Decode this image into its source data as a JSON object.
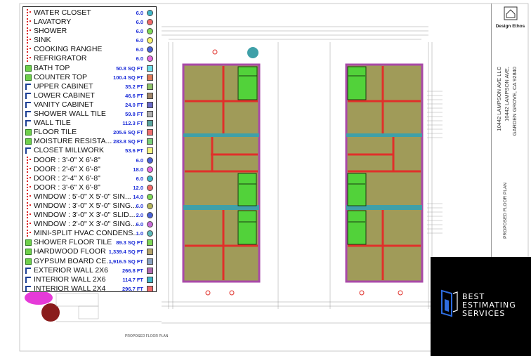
{
  "legend": {
    "items": [
      {
        "label": "WATER CLOSET",
        "value": "6.0",
        "icon": "dotted-count-icon",
        "swatch": "#3fb8c9",
        "shape": "round"
      },
      {
        "label": "LAVATORY",
        "value": "6.0",
        "icon": "dotted-count-icon",
        "swatch": "#f26a6a",
        "shape": "round"
      },
      {
        "label": "SHOWER",
        "value": "6.0",
        "icon": "dotted-count-icon",
        "swatch": "#7ed957",
        "shape": "round"
      },
      {
        "label": "SINK",
        "value": "6.0",
        "icon": "dotted-count-icon",
        "swatch": "#f5f06a",
        "shape": "round"
      },
      {
        "label": "COOKING RANGHE",
        "value": "6.0",
        "icon": "dotted-count-icon",
        "swatch": "#4a62d8",
        "shape": "round"
      },
      {
        "label": "REFRIGRATOR",
        "value": "6.0",
        "icon": "dotted-count-icon",
        "swatch": "#e96ae0",
        "shape": "round"
      },
      {
        "label": "BATH TOP",
        "value": "50.8 SQ FT",
        "icon": "area-icon",
        "swatch": "#6ee0ea",
        "shape": "square"
      },
      {
        "label": "COUNTER TOP",
        "value": "100.4 SQ FT",
        "icon": "area-icon",
        "swatch": "#e07a5a",
        "shape": "square"
      },
      {
        "label": "UPPER CABINET",
        "value": "35.2 FT",
        "icon": "linear-icon",
        "swatch": "#8fc46a",
        "shape": "square"
      },
      {
        "label": "LOWER CABINET",
        "value": "46.6 FT",
        "icon": "linear-icon",
        "swatch": "#a2876a",
        "shape": "square"
      },
      {
        "label": "VANITY CABINET",
        "value": "24.0 FT",
        "icon": "linear-icon",
        "swatch": "#6a6ac9",
        "shape": "square"
      },
      {
        "label": "SHOWER WALL TILE",
        "value": "59.8 FT",
        "icon": "linear-icon",
        "swatch": "#b0b0b0",
        "shape": "square"
      },
      {
        "label": "WALL TILE",
        "value": "112.3 FT",
        "icon": "linear-icon",
        "swatch": "#5aa6a0",
        "shape": "square"
      },
      {
        "label": "FLOOR TILE",
        "value": "205.6 SQ FT",
        "icon": "area-icon",
        "swatch": "#f07070",
        "shape": "square"
      },
      {
        "label": "MOISTURE RESISTA...",
        "value": "283.8 SQ FT",
        "icon": "area-icon",
        "swatch": "#7ad07a",
        "shape": "square"
      },
      {
        "label": "CLOSET MILLWORK",
        "value": "53.6 FT",
        "icon": "linear-icon",
        "swatch": "#f5f580",
        "shape": "square"
      },
      {
        "label": "DOOR : 3'-0\" X 6'-8\"",
        "value": "6.0",
        "icon": "dotted-count-icon",
        "swatch": "#4a62d8",
        "shape": "round"
      },
      {
        "label": "DOOR : 2'-6\" X 6'-8\"",
        "value": "18.0",
        "icon": "dotted-count-icon",
        "swatch": "#e96ae0",
        "shape": "round"
      },
      {
        "label": "DOOR : 2'-4\" X 6'-8\"",
        "value": "6.0",
        "icon": "dotted-count-icon",
        "swatch": "#3fb8c9",
        "shape": "round"
      },
      {
        "label": "DOOR : 3'-6\" X 6'-8\"",
        "value": "12.0",
        "icon": "dotted-count-icon",
        "swatch": "#f26a6a",
        "shape": "round"
      },
      {
        "label": "WINDOW : 5'-0\" X 5'-0\" SIN...",
        "value": "14.0",
        "icon": "dotted-count-icon",
        "swatch": "#7ed957",
        "shape": "round"
      },
      {
        "label": "WINDOW : 3'-0\" X 5'-0\" SING...",
        "value": "6.0",
        "icon": "dotted-count-icon",
        "swatch": "#b5b55a",
        "shape": "round"
      },
      {
        "label": "WINDOW : 3'-0\" X 3'-0\" SLID...",
        "value": "2.0",
        "icon": "dotted-count-icon",
        "swatch": "#4a62d8",
        "shape": "round"
      },
      {
        "label": "WINDOW : 2'-0\" X 3'-0\" SING...",
        "value": "6.0",
        "icon": "dotted-count-icon",
        "swatch": "#c96ad8",
        "shape": "round"
      },
      {
        "label": "MINI-SPLIT HVAC CONDENS...",
        "value": "1.0",
        "icon": "dotted-count-icon",
        "swatch": "#5ab8b8",
        "shape": "round"
      },
      {
        "label": "SHOWER FLOOR TILE",
        "value": "89.3 SQ FT",
        "icon": "area-icon",
        "swatch": "#7ed957",
        "shape": "square"
      },
      {
        "label": "HARDWOOD FLOOR",
        "value": "1,339.4 SQ FT",
        "icon": "area-icon",
        "swatch": "#b5a46a",
        "shape": "square"
      },
      {
        "label": "GYPSUM BOARD CE...",
        "value": "1,916.5 SQ FT",
        "icon": "area-icon",
        "swatch": "#8aa2c0",
        "shape": "square"
      },
      {
        "label": "EXTERIOR WALL 2X6",
        "value": "266.8 FT",
        "icon": "linear-icon",
        "swatch": "#b06ab0",
        "shape": "square"
      },
      {
        "label": "INTERIOR WALL 2X6",
        "value": "114.7 FT",
        "icon": "linear-icon",
        "swatch": "#3fb8c9",
        "shape": "square"
      },
      {
        "label": "INTERIOR WALL 2X4",
        "value": "296.7 FT",
        "icon": "linear-icon",
        "swatch": "#f26a6a",
        "shape": "square"
      }
    ]
  },
  "titleblock": {
    "firm": "Design Ethos",
    "project_line1": "10442 LAMPSON AVE LLC",
    "project_line2": "10442 LAMPSON AVE,",
    "project_line3": "GARDEN GROVE, CA 92840",
    "sheet_title": "PROPOSED FLOOR PLAN"
  },
  "plan": {
    "caption": "PROPOSED FLOOR PLAN"
  },
  "brand": {
    "line1": "BEST",
    "line2": "ESTIMATING",
    "line3": "SERVICES"
  },
  "colors": {
    "wall_exterior": "#a94aa8",
    "wall_interior": "#e0302a",
    "floor": "#8f8a3c",
    "tile": "#52d23a",
    "hvac_band": "#3fa0a8"
  }
}
